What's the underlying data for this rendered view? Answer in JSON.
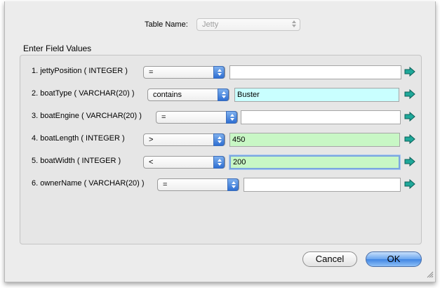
{
  "header": {
    "table_label": "Table Name:",
    "table_value": "Jetty"
  },
  "section_title": "Enter Field Values",
  "fields": [
    {
      "label": "1. jettyPosition ( INTEGER )",
      "operator": "=",
      "value": "",
      "style": "plain"
    },
    {
      "label": "2. boatType ( VARCHAR(20) )",
      "operator": "contains",
      "value": "Buster",
      "style": "cyan"
    },
    {
      "label": "3. boatEngine ( VARCHAR(20) )",
      "operator": "=",
      "value": "",
      "style": "plain"
    },
    {
      "label": "4. boatLength ( INTEGER )",
      "operator": ">",
      "value": "450",
      "style": "green"
    },
    {
      "label": "5. boatWidth ( INTEGER )",
      "operator": "<",
      "value": "200",
      "style": "green-focus"
    },
    {
      "label": "6. ownerName ( VARCHAR(20) )",
      "operator": "=",
      "value": "",
      "style": "plain"
    }
  ],
  "buttons": {
    "cancel": "Cancel",
    "ok": "OK"
  },
  "icons": {
    "go_arrow": "right-arrow-icon",
    "stepper": "popup-stepper-icon",
    "grip": "resize-grip-icon"
  },
  "colors": {
    "cyan_field": "#c9ffff",
    "green_field": "#c8f7c5",
    "arrow": "#1fa89a",
    "accent": "#3f85e3"
  }
}
